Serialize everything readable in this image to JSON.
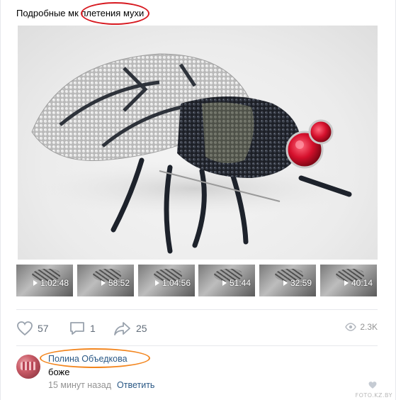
{
  "post": {
    "text_prefix": "Подробные мк ",
    "text_highlight": "плетения мухи"
  },
  "videos": [
    {
      "duration": "1:02:48"
    },
    {
      "duration": "58:52"
    },
    {
      "duration": "1:04:56"
    },
    {
      "duration": "51:44"
    },
    {
      "duration": "32:59"
    },
    {
      "duration": "40:14"
    }
  ],
  "actions": {
    "likes": "57",
    "comments": "1",
    "shares": "25",
    "views": "2.3K"
  },
  "comment": {
    "author": "Полина Объедкова",
    "text": "боже",
    "time": "15 минут назад",
    "reply_label": "Ответить"
  },
  "watermark": "FOTO.KZ.BY",
  "colors": {
    "link": "#2a5885",
    "meta": "#939393",
    "icon": "#626d7a",
    "annotation_red": "#d71920",
    "annotation_orange": "#f3861f"
  }
}
